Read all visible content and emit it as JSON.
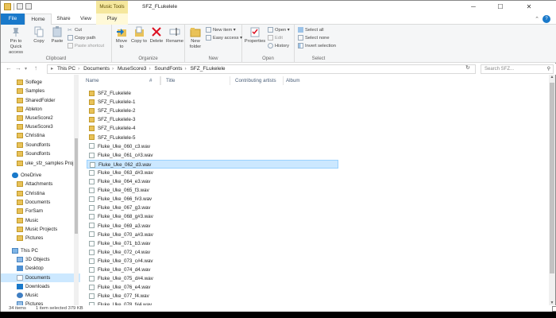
{
  "window": {
    "title": "SFZ_FLukelele",
    "context_tab_group": "Music Tools"
  },
  "window_controls": {
    "minimize": "─",
    "maximize": "☐",
    "close": "✕"
  },
  "tabs": [
    {
      "label": "File"
    },
    {
      "label": "Home"
    },
    {
      "label": "Share"
    },
    {
      "label": "View"
    },
    {
      "label": "Play"
    }
  ],
  "help": "?",
  "ribbon": {
    "clipboard": {
      "label": "Clipboard",
      "pin": "Pin to Quick access",
      "copy": "Copy",
      "paste": "Paste",
      "cut": "Cut",
      "copy_path": "Copy path",
      "paste_shortcut": "Paste shortcut"
    },
    "organize": {
      "label": "Organize",
      "move_to": "Move to",
      "copy_to": "Copy to",
      "delete": "Delete",
      "rename": "Rename"
    },
    "new": {
      "label": "New",
      "new_folder": "New folder",
      "new_item": "New item",
      "easy_access": "Easy access"
    },
    "open": {
      "label": "Open",
      "properties": "Properties",
      "open": "Open",
      "edit": "Edit",
      "history": "History"
    },
    "select": {
      "label": "Select",
      "select_all": "Select all",
      "select_none": "Select none",
      "invert": "Invert selection"
    }
  },
  "address": {
    "crumbs": [
      "This PC",
      "Documents",
      "MuseScore3",
      "SoundFonts",
      "SFZ_FLukelele"
    ],
    "search_placeholder": "Search SFZ..."
  },
  "nav_pane": {
    "items": [
      {
        "label": "Solfege",
        "icon": "folder"
      },
      {
        "label": "Samples",
        "icon": "folder"
      },
      {
        "label": "SharedFolder",
        "icon": "folder"
      },
      {
        "label": "Ableton",
        "icon": "folder"
      },
      {
        "label": "MuseScore2",
        "icon": "folder"
      },
      {
        "label": "MuseScore3",
        "icon": "folder"
      },
      {
        "label": "Christina",
        "icon": "folder"
      },
      {
        "label": "Soundfonts",
        "icon": "folder"
      },
      {
        "label": "Soundfonts",
        "icon": "folder"
      },
      {
        "label": "uke_sfz_samples Proj",
        "icon": "folder"
      },
      {
        "label": "OneDrive",
        "icon": "cloud"
      },
      {
        "label": "Attachments",
        "icon": "folder"
      },
      {
        "label": "Christina",
        "icon": "folder"
      },
      {
        "label": "Documents",
        "icon": "folder"
      },
      {
        "label": "ForSam",
        "icon": "folder"
      },
      {
        "label": "Music",
        "icon": "folder"
      },
      {
        "label": "Music Projects",
        "icon": "folder"
      },
      {
        "label": "Pictures",
        "icon": "folder"
      },
      {
        "label": "This PC",
        "icon": "pc"
      },
      {
        "label": "3D Objects",
        "icon": "3d"
      },
      {
        "label": "Desktop",
        "icon": "desktop"
      },
      {
        "label": "Documents",
        "icon": "docs"
      },
      {
        "label": "Downloads",
        "icon": "download"
      },
      {
        "label": "Music",
        "icon": "music"
      },
      {
        "label": "Pictures",
        "icon": "pictures"
      }
    ]
  },
  "columns": [
    "Name",
    "#",
    "Title",
    "Contributing artists",
    "Album"
  ],
  "files": [
    {
      "name": "SFZ_FLukelele",
      "type": "folder"
    },
    {
      "name": "SFZ_FLukelele-1",
      "type": "folder"
    },
    {
      "name": "SFZ_FLukelele-2",
      "type": "folder"
    },
    {
      "name": "SFZ_FLukelele-3",
      "type": "folder"
    },
    {
      "name": "SFZ_FLukelele-4",
      "type": "folder"
    },
    {
      "name": "SFZ_FLukelele-5",
      "type": "folder"
    },
    {
      "name": "Fluke_Uke_060_c3.wav",
      "type": "wav"
    },
    {
      "name": "Fluke_Uke_061_c#3.wav",
      "type": "wav"
    },
    {
      "name": "Fluke_Uke_062_d3.wav",
      "type": "wav",
      "selected": true
    },
    {
      "name": "Fluke_Uke_063_d#3.wav",
      "type": "wav"
    },
    {
      "name": "Fluke_Uke_064_e3.wav",
      "type": "wav"
    },
    {
      "name": "Fluke_Uke_065_f3.wav",
      "type": "wav"
    },
    {
      "name": "Fluke_Uke_066_f#3.wav",
      "type": "wav"
    },
    {
      "name": "Fluke_Uke_067_g3.wav",
      "type": "wav"
    },
    {
      "name": "Fluke_Uke_068_g#3.wav",
      "type": "wav"
    },
    {
      "name": "Fluke_Uke_069_a3.wav",
      "type": "wav"
    },
    {
      "name": "Fluke_Uke_070_a#3.wav",
      "type": "wav"
    },
    {
      "name": "Fluke_Uke_071_b3.wav",
      "type": "wav"
    },
    {
      "name": "Fluke_Uke_072_c4.wav",
      "type": "wav"
    },
    {
      "name": "Fluke_Uke_073_c#4.wav",
      "type": "wav"
    },
    {
      "name": "Fluke_Uke_074_d4.wav",
      "type": "wav"
    },
    {
      "name": "Fluke_Uke_075_d#4.wav",
      "type": "wav"
    },
    {
      "name": "Fluke_Uke_076_e4.wav",
      "type": "wav"
    },
    {
      "name": "Fluke_Uke_077_f4.wav",
      "type": "wav"
    },
    {
      "name": "Fluke_Uke_078_f#4.wav",
      "type": "wav"
    }
  ],
  "status": {
    "count": "34 items",
    "selection": "1 item selected  379 KB"
  },
  "colors": {
    "accent": "#1979ca",
    "selection": "#cce8ff",
    "context_tab": "#f5e79d"
  }
}
